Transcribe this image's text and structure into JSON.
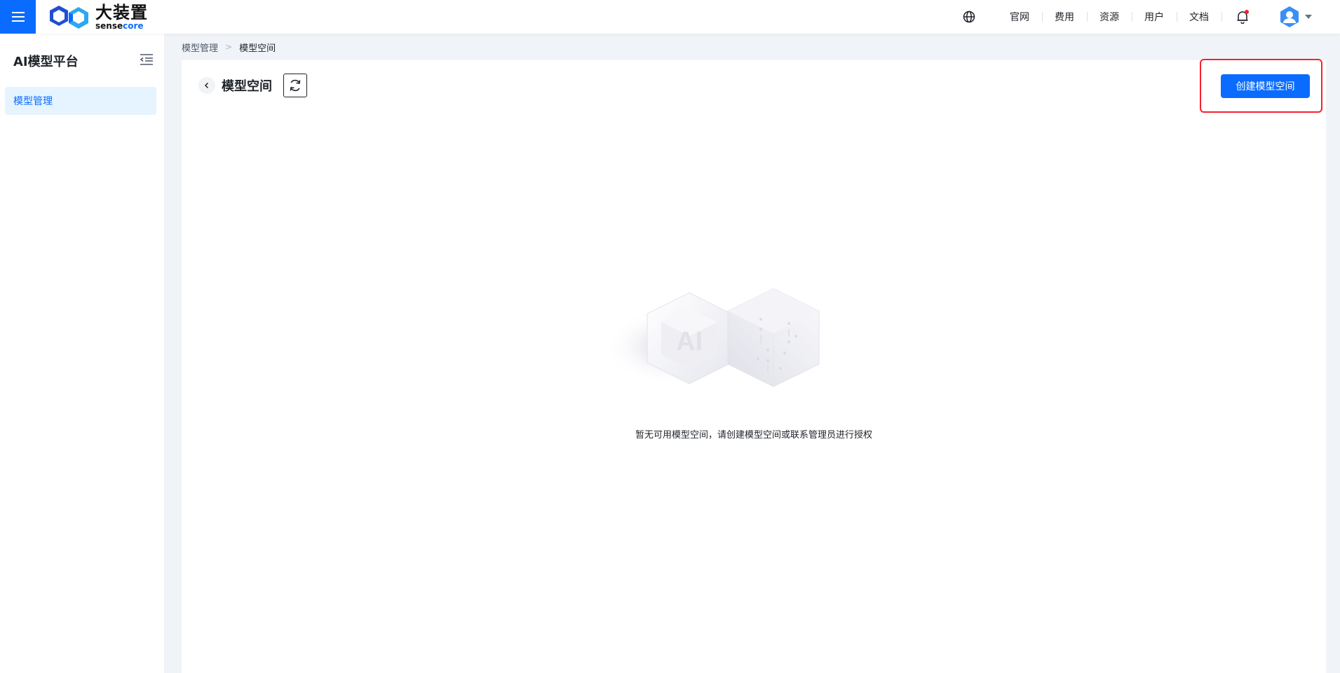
{
  "header": {
    "logo_cn": "大装置",
    "logo_en_prefix": "sense",
    "logo_en_accent": "core",
    "nav": [
      "官网",
      "费用",
      "资源",
      "用户",
      "文档"
    ]
  },
  "sidebar": {
    "title": "AI模型平台",
    "items": [
      {
        "label": "模型管理",
        "active": true
      }
    ]
  },
  "breadcrumb": [
    "模型管理",
    "模型空间"
  ],
  "page": {
    "title": "模型空间",
    "create_button": "创建模型空间",
    "empty_text": "暂无可用模型空间，请创建模型空间或联系管理员进行授权",
    "illustration_label": "AI"
  },
  "colors": {
    "primary": "#0a6cff",
    "highlight": "#f5222d"
  }
}
